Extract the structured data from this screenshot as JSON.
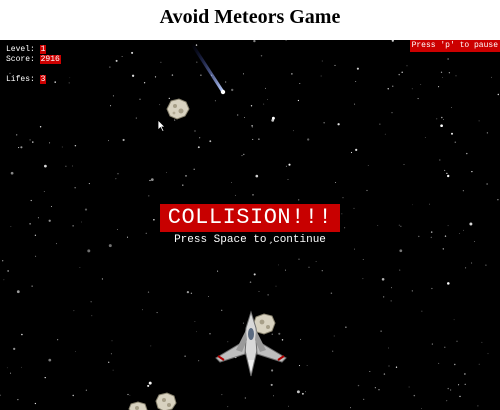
{
  "page": {
    "title": "Avoid Meteors Game"
  },
  "hud": {
    "level_label": "Level:",
    "level_value": "1",
    "score_label": "Score:",
    "score_value": "2916",
    "lifes_label": "Lifes:",
    "lifes_value": "3",
    "pause_hint": "Press 'p' to pause"
  },
  "overlay": {
    "collision_text": "COLLISION!!!",
    "continue_text": "Press Space to continue"
  },
  "colors": {
    "accent_red": "#cc0000",
    "background": "#000000"
  },
  "sprites": {
    "player": "spaceship-icon",
    "meteor": "meteor-icon",
    "shooting_star": "shooting-star-icon",
    "cursor": "mouse-cursor-icon"
  }
}
